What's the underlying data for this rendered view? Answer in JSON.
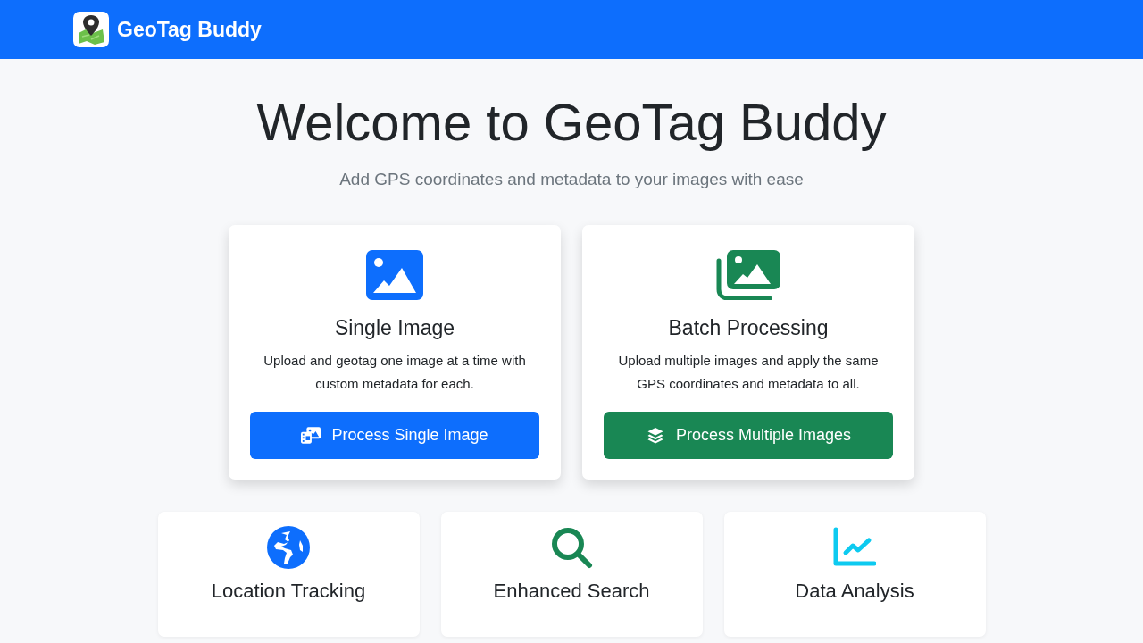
{
  "navbar": {
    "brand": "GeoTag Buddy"
  },
  "hero": {
    "title": "Welcome to GeoTag Buddy",
    "subtitle": "Add GPS coordinates and metadata to your images with ease"
  },
  "modes": [
    {
      "kind": "single",
      "color": "#0d6efd",
      "title": "Single Image",
      "description": "Upload and geotag one image at a time with custom metadata for each.",
      "button": "Process Single Image"
    },
    {
      "kind": "batch",
      "color": "#198754",
      "title": "Batch Processing",
      "description": "Upload multiple images and apply the same GPS coordinates and metadata to all.",
      "button": "Process Multiple Images"
    }
  ],
  "features": [
    {
      "kind": "globe",
      "color": "#0d6efd",
      "title": "Location Tracking"
    },
    {
      "kind": "search",
      "color": "#198754",
      "title": "Enhanced Search"
    },
    {
      "kind": "chart",
      "color": "#0dcaf0",
      "title": "Data Analysis"
    }
  ]
}
